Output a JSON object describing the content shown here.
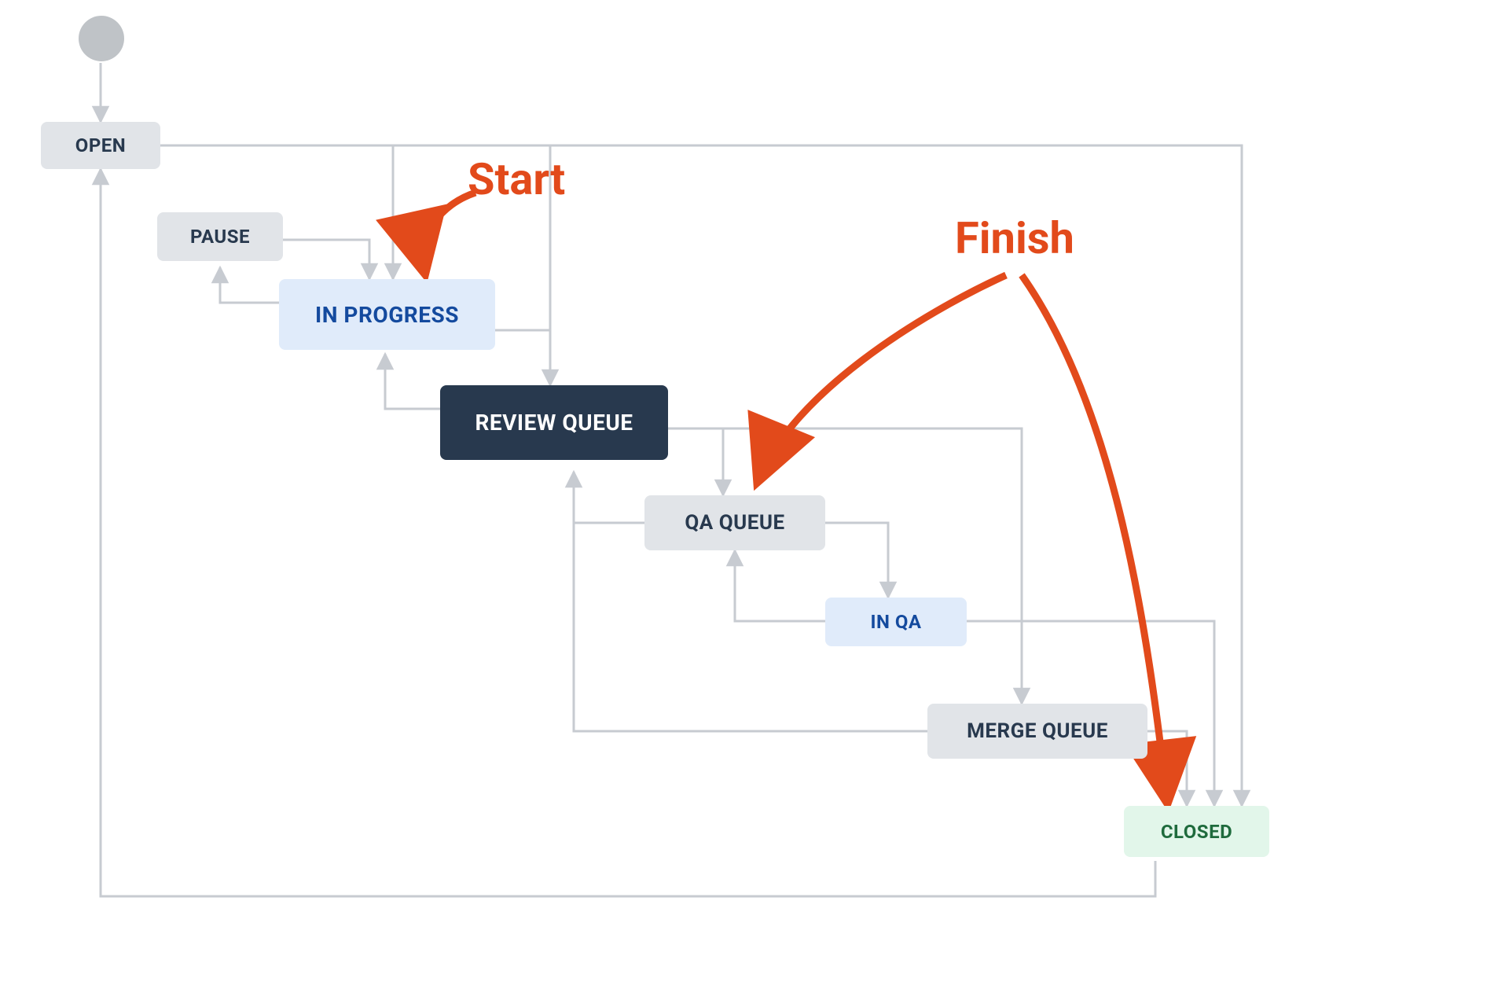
{
  "nodes": {
    "open": {
      "label": "OPEN"
    },
    "pause": {
      "label": "PAUSE"
    },
    "in_progress": {
      "label": "IN PROGRESS"
    },
    "review_queue": {
      "label": "REVIEW QUEUE"
    },
    "qa_queue": {
      "label": "QA QUEUE"
    },
    "in_qa": {
      "label": "IN QA"
    },
    "merge_queue": {
      "label": "MERGE QUEUE"
    },
    "closed": {
      "label": "CLOSED"
    }
  },
  "annotations": {
    "start": {
      "label": "Start"
    },
    "finish": {
      "label": "Finish"
    }
  },
  "edges_description": [
    "start-dot -> OPEN",
    "OPEN -> IN PROGRESS",
    "OPEN -> (far right down) -> CLOSED",
    "PAUSE -> IN PROGRESS",
    "IN PROGRESS -> PAUSE",
    "IN PROGRESS -> REVIEW QUEUE",
    "REVIEW QUEUE -> IN PROGRESS",
    "REVIEW QUEUE -> QA QUEUE",
    "REVIEW QUEUE -> (right branch) -> MERGE QUEUE / CLOSED",
    "QA QUEUE -> REVIEW QUEUE",
    "QA QUEUE -> IN QA",
    "IN QA -> QA QUEUE",
    "IN QA -> MERGE QUEUE",
    "IN QA -> (right) -> CLOSED",
    "MERGE QUEUE -> QA QUEUE (left/up)",
    "MERGE QUEUE -> CLOSED",
    "CLOSED -> OPEN (bottom loop back)"
  ],
  "colors": {
    "edge": "#C7CBD1",
    "node_grey": "#E1E4E8",
    "node_blue": "#E0EBFA",
    "node_dark": "#28394e",
    "node_green": "#E2F6EA",
    "annotation": "#E24A1B"
  }
}
